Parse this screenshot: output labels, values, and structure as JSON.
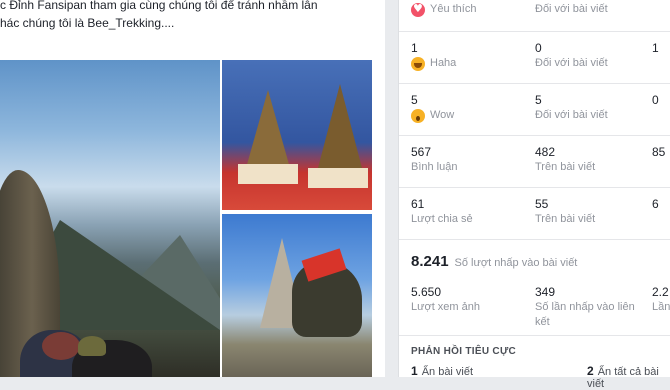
{
  "post": {
    "line1": "c Đỉnh Fansipan tham gia cùng chúng tôi để tránh nhầm lẫn",
    "line2": "hác chúng tôi là Bee_Trekking...."
  },
  "stats": {
    "row0": {
      "c1_label": "Yêu thích",
      "c2_label": "Đối với bài viết"
    },
    "row1": {
      "c1_num": "1",
      "c1_label": "Haha",
      "c2_num": "0",
      "c2_label": "Đối với bài viết",
      "c3_num": "1"
    },
    "row2": {
      "c1_num": "5",
      "c1_label": "Wow",
      "c2_num": "5",
      "c2_label": "Đối với bài viết",
      "c3_num": "0"
    },
    "row3": {
      "c1_num": "567",
      "c1_label": "Bình luận",
      "c2_num": "482",
      "c2_label": "Trên bài viết",
      "c3_num": "85"
    },
    "row4": {
      "c1_num": "61",
      "c1_label": "Lượt chia sẻ",
      "c2_num": "55",
      "c2_label": "Trên bài viết",
      "c3_num": "6"
    },
    "clicks": {
      "num": "8.241",
      "label": "Số lượt nhấp vào bài viết"
    },
    "row5": {
      "c1_num": "5.650",
      "c1_label": "Lượt xem ảnh",
      "c2_num": "349",
      "c2_label_a": "Số lần nhấp vào liên",
      "c2_label_b": "kết",
      "c3_num": "2.2",
      "c3_label": "Lần"
    }
  },
  "negative": {
    "title": "PHẢN HỒI TIÊU CỰC",
    "item1_num": "1",
    "item1_label": "Ẩn bài viết",
    "item2_num": "2",
    "item2_label": "Ẩn tất cả bài viết"
  },
  "icons": [
    "heart-reaction-icon",
    "haha-reaction-icon",
    "wow-reaction-icon"
  ],
  "colors": {
    "heart": "#f25268",
    "reaction_yellow": "#f7b125",
    "muted_text": "#90949c"
  }
}
